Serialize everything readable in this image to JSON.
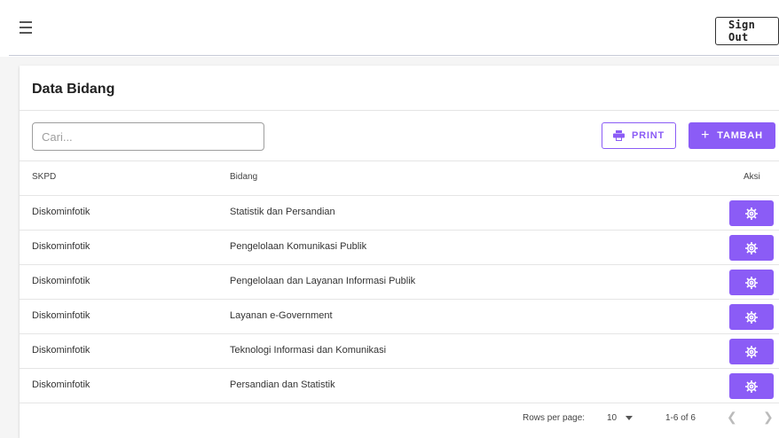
{
  "header": {
    "signout_label": "Sign Out"
  },
  "card": {
    "title": "Data Bidang",
    "search_placeholder": "Cari...",
    "print_label": "PRINT",
    "tambah_label": "TAMBAH"
  },
  "table": {
    "columns": {
      "skpd": "SKPD",
      "bidang": "Bidang",
      "aksi": "Aksi"
    },
    "rows": [
      {
        "skpd": "Diskominfotik",
        "bidang": "Statistik dan Persandian"
      },
      {
        "skpd": "Diskominfotik",
        "bidang": "Pengelolaan Komunikasi Publik"
      },
      {
        "skpd": "Diskominfotik",
        "bidang": "Pengelolaan dan Layanan Informasi Publik"
      },
      {
        "skpd": "Diskominfotik",
        "bidang": "Layanan e-Government"
      },
      {
        "skpd": "Diskominfotik",
        "bidang": "Teknologi Informasi dan Komunikasi"
      },
      {
        "skpd": "Diskominfotik",
        "bidang": "Persandian dan Statistik"
      }
    ]
  },
  "pagination": {
    "rows_per_page_label": "Rows per page:",
    "rows_per_page_value": "10",
    "range": "1-6 of 6"
  },
  "colors": {
    "accent": "#8b5cf6"
  },
  "icons": {
    "menu": "hamburger-icon",
    "print": "printer-icon",
    "add": "plus-icon",
    "action": "gear-icon"
  }
}
